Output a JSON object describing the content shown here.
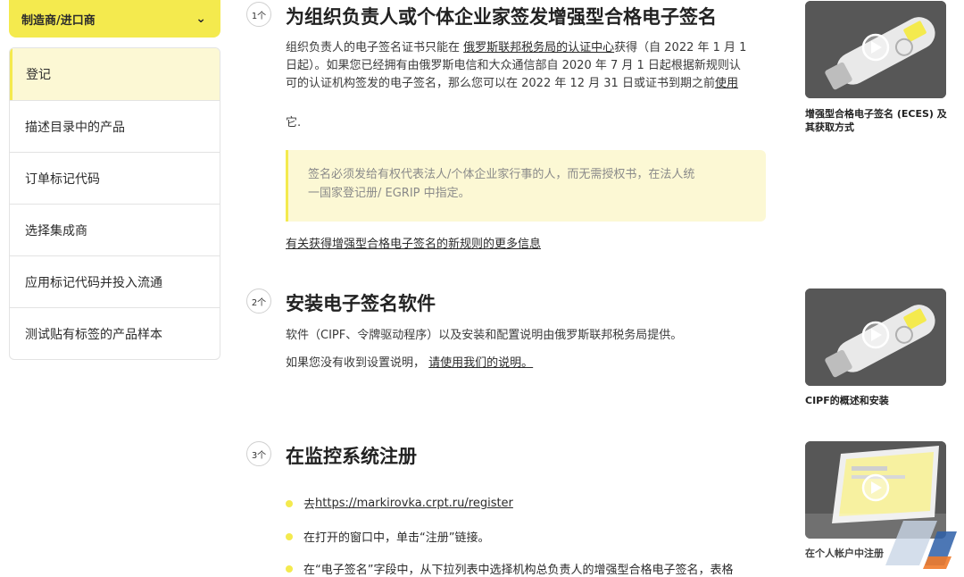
{
  "sidebar": {
    "role_select": "制造商/进口商",
    "items": [
      {
        "label": "登记"
      },
      {
        "label": "描述目录中的产品"
      },
      {
        "label": "订单标记代码"
      },
      {
        "label": "选择集成商"
      },
      {
        "label": "应用标记代码并投入流通"
      },
      {
        "label": "测试贴有标签的产品样本"
      }
    ]
  },
  "steps": [
    {
      "badge": "1个",
      "title": "为组织负责人或个体企业家签发增强型合格电子签名",
      "p1_line1_a": "组织负责人的电子签名证书只能在 ",
      "p1_line1_link": "俄罗斯联邦税务局的认证中心",
      "p1_line1_b": "获得（自 2022 年 1 月 1",
      "p1_line2": "日起）。如果您已经拥有由俄罗斯电信和大众通信部自 2020 年 7 月 1 日起根据新规则认",
      "p1_line3_a": "可的认证机构签发的电子签名，那么您可以在 2022 年 12 月 31 日或证书到期之前",
      "p1_line3_link": "使用",
      "p1_line4": "它.",
      "note_line1": "签名必须发给有权代表法人/个体企业家行事的人，而无需授权书，在法人统",
      "note_line2": "一国家登记册/ EGRIP 中指定。",
      "more_link": "有关获得增强型合格电子签名的新规则的更多信息"
    },
    {
      "badge": "2个",
      "title": "安装电子签名软件",
      "p1": "软件（CIPF、令牌驱动程序）以及安装和配置说明由俄罗斯联邦税务局提供。",
      "p2_a": "如果您没有收到设置说明，",
      "p2_link": "请使用我们的说明。"
    },
    {
      "badge": "3个",
      "title": "在监控系统注册",
      "bullet1_a": "去",
      "bullet1_link": "https://markirovka.crpt.ru/register",
      "bullet2": "在打开的窗口中，单击“注册”链接。",
      "bullet3": "在“电子签名”字段中，从下拉列表中选择机构总负责人的增强型合格电子签名，表格"
    }
  ],
  "videos": [
    {
      "caption": "增强型合格电子签名 (ECES) 及其获取方式",
      "icon": "usb-token"
    },
    {
      "caption": "CIPF的概述和安装",
      "icon": "usb-token"
    },
    {
      "caption": "在个人帐户中注册",
      "icon": "laptop"
    }
  ],
  "colors": {
    "accent": "#f4ea4e",
    "accent_light": "#fcf8d4",
    "thumb_bg": "#575757"
  }
}
